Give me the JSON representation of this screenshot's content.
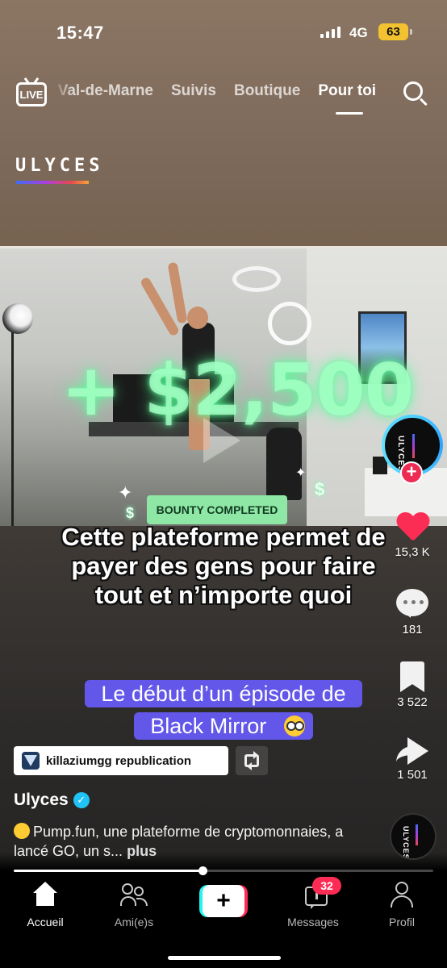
{
  "status_bar": {
    "time": "15:47",
    "network": "4G",
    "battery": "63"
  },
  "top_nav": {
    "live_label": "LIVE",
    "tabs": [
      {
        "label": "Val-de-Marne"
      },
      {
        "label": "Suivis"
      },
      {
        "label": "Boutique"
      },
      {
        "label": "Pour toi"
      }
    ],
    "active_tab": "Pour toi"
  },
  "brand": {
    "logo_text": "ULYCES"
  },
  "video": {
    "overlay_amount": "+ $2,500",
    "bounty_label": "BOUNTY COMPLETED",
    "caption_main": "Cette plateforme permet de payer des gens pour faire tout et n’importe quoi",
    "caption_purple": "Le début d’un épisode de Black Mirror"
  },
  "creator": {
    "avatar_text": "ULYCES",
    "name": "Ulyces"
  },
  "actions": {
    "likes": "15,3 K",
    "comments": "181",
    "saves": "3 522",
    "shares": "1 501"
  },
  "repost": {
    "text": "killaziumgg republication"
  },
  "description": {
    "text": "Pump.fun, une plateforme de cryptomonnaies, a lancé GO, un s...",
    "more_label": "plus"
  },
  "playback": {
    "progress": 0.45
  },
  "bottom_nav": {
    "items": [
      {
        "label": "Accueil",
        "icon": "home-icon"
      },
      {
        "label": "Ami(e)s",
        "icon": "friends-icon"
      },
      {
        "label": "",
        "icon": "create-icon"
      },
      {
        "label": "Messages",
        "icon": "inbox-icon"
      },
      {
        "label": "Profil",
        "icon": "profile-icon"
      }
    ],
    "messages_badge": "32"
  },
  "colors": {
    "like": "#fb2d55",
    "caption_bg": "#6257e8",
    "bounty_bg": "#8ee7a5",
    "badge": "#fe2c55",
    "battery": "#f2c230"
  }
}
